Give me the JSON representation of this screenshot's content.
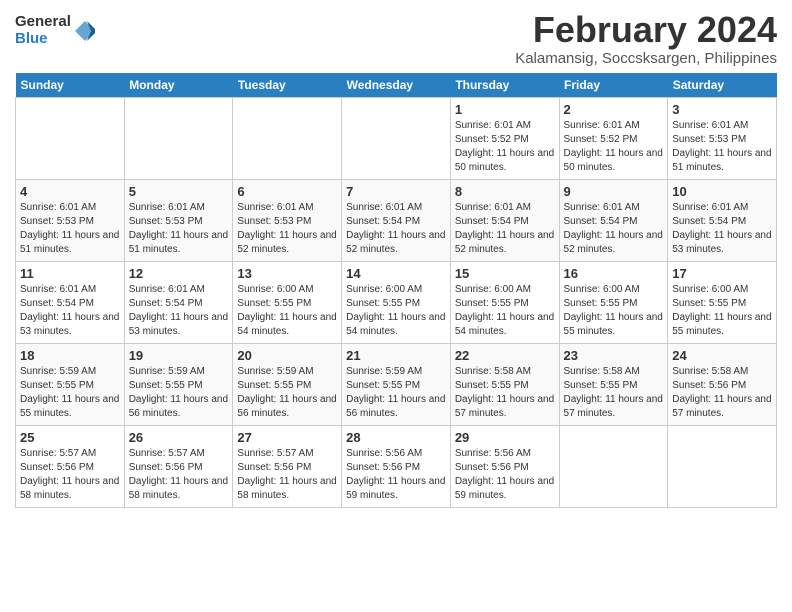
{
  "logo": {
    "general": "General",
    "blue": "Blue"
  },
  "title": "February 2024",
  "location": "Kalamansig, Soccsksargen, Philippines",
  "days_of_week": [
    "Sunday",
    "Monday",
    "Tuesday",
    "Wednesday",
    "Thursday",
    "Friday",
    "Saturday"
  ],
  "weeks": [
    [
      {
        "day": "",
        "info": ""
      },
      {
        "day": "",
        "info": ""
      },
      {
        "day": "",
        "info": ""
      },
      {
        "day": "",
        "info": ""
      },
      {
        "day": "1",
        "info": "Sunrise: 6:01 AM\nSunset: 5:52 PM\nDaylight: 11 hours and 50 minutes."
      },
      {
        "day": "2",
        "info": "Sunrise: 6:01 AM\nSunset: 5:52 PM\nDaylight: 11 hours and 50 minutes."
      },
      {
        "day": "3",
        "info": "Sunrise: 6:01 AM\nSunset: 5:53 PM\nDaylight: 11 hours and 51 minutes."
      }
    ],
    [
      {
        "day": "4",
        "info": "Sunrise: 6:01 AM\nSunset: 5:53 PM\nDaylight: 11 hours and 51 minutes."
      },
      {
        "day": "5",
        "info": "Sunrise: 6:01 AM\nSunset: 5:53 PM\nDaylight: 11 hours and 51 minutes."
      },
      {
        "day": "6",
        "info": "Sunrise: 6:01 AM\nSunset: 5:53 PM\nDaylight: 11 hours and 52 minutes."
      },
      {
        "day": "7",
        "info": "Sunrise: 6:01 AM\nSunset: 5:54 PM\nDaylight: 11 hours and 52 minutes."
      },
      {
        "day": "8",
        "info": "Sunrise: 6:01 AM\nSunset: 5:54 PM\nDaylight: 11 hours and 52 minutes."
      },
      {
        "day": "9",
        "info": "Sunrise: 6:01 AM\nSunset: 5:54 PM\nDaylight: 11 hours and 52 minutes."
      },
      {
        "day": "10",
        "info": "Sunrise: 6:01 AM\nSunset: 5:54 PM\nDaylight: 11 hours and 53 minutes."
      }
    ],
    [
      {
        "day": "11",
        "info": "Sunrise: 6:01 AM\nSunset: 5:54 PM\nDaylight: 11 hours and 53 minutes."
      },
      {
        "day": "12",
        "info": "Sunrise: 6:01 AM\nSunset: 5:54 PM\nDaylight: 11 hours and 53 minutes."
      },
      {
        "day": "13",
        "info": "Sunrise: 6:00 AM\nSunset: 5:55 PM\nDaylight: 11 hours and 54 minutes."
      },
      {
        "day": "14",
        "info": "Sunrise: 6:00 AM\nSunset: 5:55 PM\nDaylight: 11 hours and 54 minutes."
      },
      {
        "day": "15",
        "info": "Sunrise: 6:00 AM\nSunset: 5:55 PM\nDaylight: 11 hours and 54 minutes."
      },
      {
        "day": "16",
        "info": "Sunrise: 6:00 AM\nSunset: 5:55 PM\nDaylight: 11 hours and 55 minutes."
      },
      {
        "day": "17",
        "info": "Sunrise: 6:00 AM\nSunset: 5:55 PM\nDaylight: 11 hours and 55 minutes."
      }
    ],
    [
      {
        "day": "18",
        "info": "Sunrise: 5:59 AM\nSunset: 5:55 PM\nDaylight: 11 hours and 55 minutes."
      },
      {
        "day": "19",
        "info": "Sunrise: 5:59 AM\nSunset: 5:55 PM\nDaylight: 11 hours and 56 minutes."
      },
      {
        "day": "20",
        "info": "Sunrise: 5:59 AM\nSunset: 5:55 PM\nDaylight: 11 hours and 56 minutes."
      },
      {
        "day": "21",
        "info": "Sunrise: 5:59 AM\nSunset: 5:55 PM\nDaylight: 11 hours and 56 minutes."
      },
      {
        "day": "22",
        "info": "Sunrise: 5:58 AM\nSunset: 5:55 PM\nDaylight: 11 hours and 57 minutes."
      },
      {
        "day": "23",
        "info": "Sunrise: 5:58 AM\nSunset: 5:55 PM\nDaylight: 11 hours and 57 minutes."
      },
      {
        "day": "24",
        "info": "Sunrise: 5:58 AM\nSunset: 5:56 PM\nDaylight: 11 hours and 57 minutes."
      }
    ],
    [
      {
        "day": "25",
        "info": "Sunrise: 5:57 AM\nSunset: 5:56 PM\nDaylight: 11 hours and 58 minutes."
      },
      {
        "day": "26",
        "info": "Sunrise: 5:57 AM\nSunset: 5:56 PM\nDaylight: 11 hours and 58 minutes."
      },
      {
        "day": "27",
        "info": "Sunrise: 5:57 AM\nSunset: 5:56 PM\nDaylight: 11 hours and 58 minutes."
      },
      {
        "day": "28",
        "info": "Sunrise: 5:56 AM\nSunset: 5:56 PM\nDaylight: 11 hours and 59 minutes."
      },
      {
        "day": "29",
        "info": "Sunrise: 5:56 AM\nSunset: 5:56 PM\nDaylight: 11 hours and 59 minutes."
      },
      {
        "day": "",
        "info": ""
      },
      {
        "day": "",
        "info": ""
      }
    ]
  ]
}
